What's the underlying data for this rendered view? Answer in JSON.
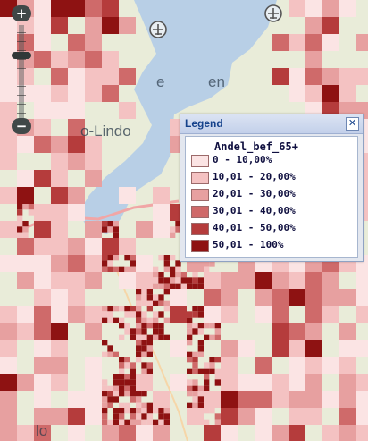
{
  "map": {
    "colors": {
      "land": "#e9ecd9",
      "water": "#b8cfe6",
      "road": "#f1a6a6",
      "grid_line": "#a01e1e"
    },
    "class_colors": [
      "#fbe4e4",
      "#f4c2c2",
      "#e7a0a0",
      "#cf6a6a",
      "#b53c3c",
      "#8e1212"
    ],
    "place_labels": [
      {
        "name": "place-label-lindo",
        "text": "o-Lindo"
      },
      {
        "name": "place-label-en",
        "text": "en"
      },
      {
        "name": "place-label-e",
        "text": "e"
      },
      {
        "name": "place-label-lo",
        "text": "lo"
      }
    ]
  },
  "zoom_control": {
    "in_label": "+",
    "out_label": "−"
  },
  "legend": {
    "title": "Legend",
    "close_label": "✕",
    "field": "Andel_bef_65+",
    "items": [
      {
        "label": "0 - 10,00%",
        "color": "#fbe4e4"
      },
      {
        "label": "10,01 - 20,00%",
        "color": "#f4c2c2"
      },
      {
        "label": "20,01 - 30,00%",
        "color": "#e7a0a0"
      },
      {
        "label": "30,01 - 40,00%",
        "color": "#cf6a6a"
      },
      {
        "label": "40,01 - 50,00%",
        "color": "#b53c3c"
      },
      {
        "label": "50,01 - 100%",
        "color": "#8e1212"
      }
    ]
  }
}
